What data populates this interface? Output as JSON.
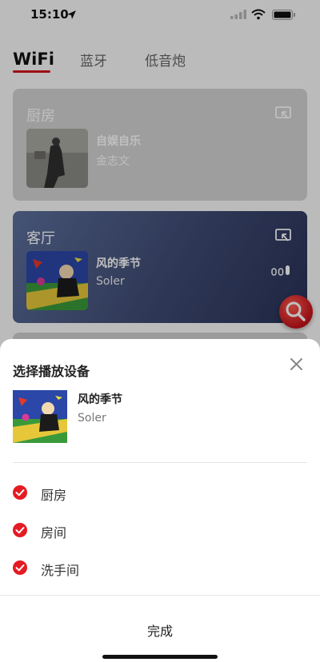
{
  "status_bar": {
    "time": "15:10"
  },
  "tabs": [
    {
      "label": "WiFi",
      "active": true
    },
    {
      "label": "蓝牙",
      "active": false
    },
    {
      "label": "低音炮",
      "active": false
    }
  ],
  "rooms": [
    {
      "name": "厨房",
      "song": "自娱自乐",
      "artist": "金志文"
    },
    {
      "name": "客厅",
      "song": "风的季节",
      "artist": "Soler"
    }
  ],
  "colors": {
    "accent": "#d40f1c",
    "check": "#e41b23"
  },
  "sheet": {
    "title": "选择播放设备",
    "now_playing": {
      "song": "风的季节",
      "artist": "Soler"
    },
    "devices": [
      {
        "label": "厨房",
        "checked": true
      },
      {
        "label": "房间",
        "checked": true
      },
      {
        "label": "洗手间",
        "checked": true
      }
    ],
    "done_label": "完成"
  }
}
